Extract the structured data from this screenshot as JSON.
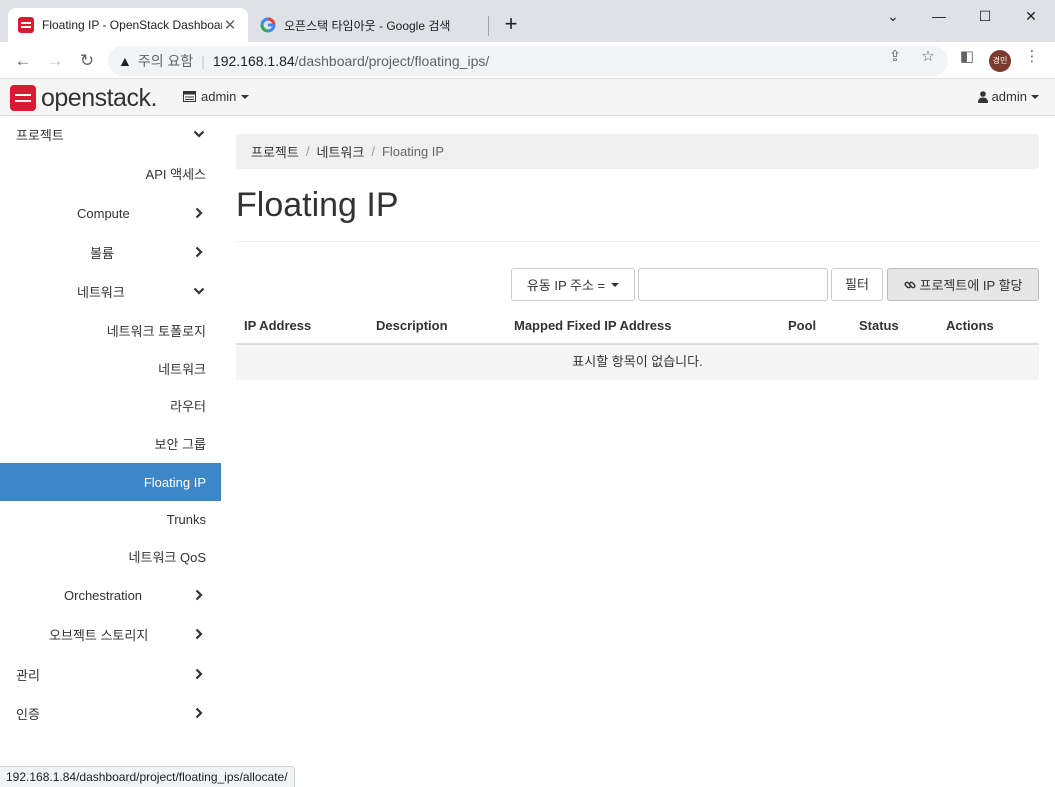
{
  "browser": {
    "tabs": [
      {
        "title": "Floating IP - OpenStack Dashboard",
        "active": true
      },
      {
        "title": "오픈스택 타임아웃 - Google 검색",
        "active": false
      }
    ],
    "new_tab": "+",
    "window_controls": {
      "minimize": "—",
      "maximize": "☐",
      "close": "✕"
    },
    "address": {
      "security_text": "주의 요함",
      "host": "192.168.1.84",
      "path": "/dashboard/project/floating_ips/"
    },
    "profile_initials": "경민",
    "status_url": "192.168.1.84/dashboard/project/floating_ips/allocate/"
  },
  "topnav": {
    "logo_text": "openstack.",
    "project_menu": "admin",
    "user_menu": "admin"
  },
  "sidebar": {
    "items": [
      {
        "label": "프로젝트",
        "chevron": "down"
      },
      {
        "label": "API 액세스"
      },
      {
        "label": "Compute",
        "chevron": "right"
      },
      {
        "label": "볼륨",
        "chevron": "right"
      },
      {
        "label": "네트워크",
        "chevron": "down"
      },
      {
        "label": "네트워크 토폴로지"
      },
      {
        "label": "네트워크"
      },
      {
        "label": "라우터"
      },
      {
        "label": "보안 그룹"
      },
      {
        "label": "Floating IP",
        "active": true
      },
      {
        "label": "Trunks"
      },
      {
        "label": "네트워크 QoS"
      },
      {
        "label": "Orchestration",
        "chevron": "right"
      },
      {
        "label": "오브젝트 스토리지",
        "chevron": "right"
      },
      {
        "label": "관리",
        "chevron": "right"
      },
      {
        "label": "인증",
        "chevron": "right"
      }
    ]
  },
  "breadcrumb": [
    "프로젝트",
    "네트워크",
    "Floating IP"
  ],
  "page_title": "Floating IP",
  "filter": {
    "select_value": "유동 IP 주소 =",
    "input_value": "",
    "filter_button": "필터",
    "allocate_button": "프로젝트에 IP 할당"
  },
  "table": {
    "columns": [
      "IP Address",
      "Description",
      "Mapped Fixed IP Address",
      "Pool",
      "Status",
      "Actions"
    ],
    "empty_message": "표시할 항목이 없습니다."
  }
}
